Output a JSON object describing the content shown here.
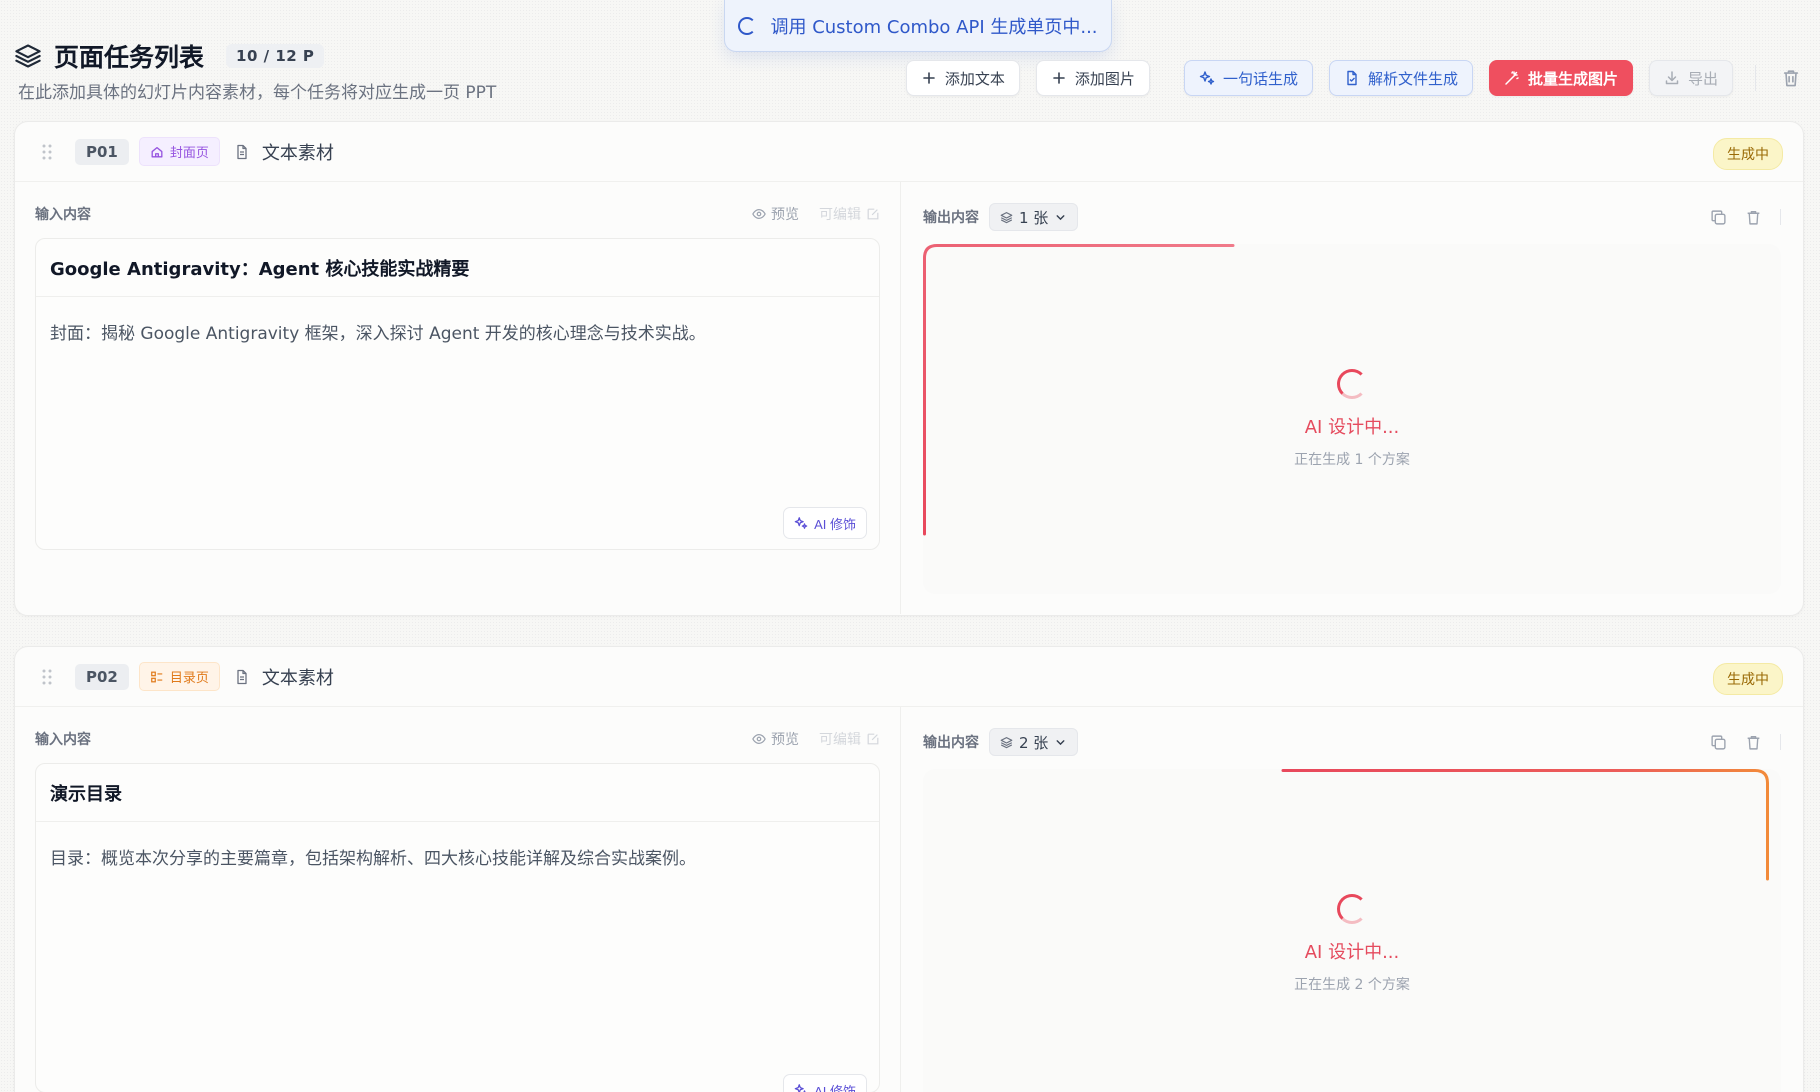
{
  "toast": {
    "text": "调用 Custom Combo API 生成单页中..."
  },
  "header": {
    "title": "页面任务列表",
    "count": "10 / 12 P",
    "subtitle": "在此添加具体的幻灯片内容素材，每个任务将对应生成一页 PPT"
  },
  "toolbar": {
    "add_text": "添加文本",
    "add_image": "添加图片",
    "one_sentence": "一句话生成",
    "parse_file": "解析文件生成",
    "batch_image": "批量生成图片",
    "export": "导出"
  },
  "colors": {
    "accent_red": "#ef4f5f",
    "accent_blue": "#3060cc",
    "status_yellow": "#fbf5c8"
  },
  "tasks": [
    {
      "page_no": "P01",
      "type_label": "封面页",
      "source_label": "文本素材",
      "status": "生成中",
      "input_label": "输入内容",
      "preview_label": "预览",
      "editable_label": "可编辑",
      "input_title": "Google Antigravity：Agent 核心技能实战精要",
      "input_text": "封面：揭秘 Google Antigravity 框架，深入探讨 Agent 开发的核心理念与技术实战。",
      "ai_button": "AI 修饰",
      "output_label": "输出内容",
      "output_count": "1 张",
      "gen_title": "AI 设计中...",
      "gen_sub": "正在生成 1 个方案"
    },
    {
      "page_no": "P02",
      "type_label": "目录页",
      "source_label": "文本素材",
      "status": "生成中",
      "input_label": "输入内容",
      "preview_label": "预览",
      "editable_label": "可编辑",
      "input_title": "演示目录",
      "input_text": "目录：概览本次分享的主要篇章，包括架构解析、四大核心技能详解及综合实战案例。",
      "ai_button": "AI 修饰",
      "output_label": "输出内容",
      "output_count": "2 张",
      "gen_title": "AI 设计中...",
      "gen_sub": "正在生成 2 个方案"
    }
  ]
}
